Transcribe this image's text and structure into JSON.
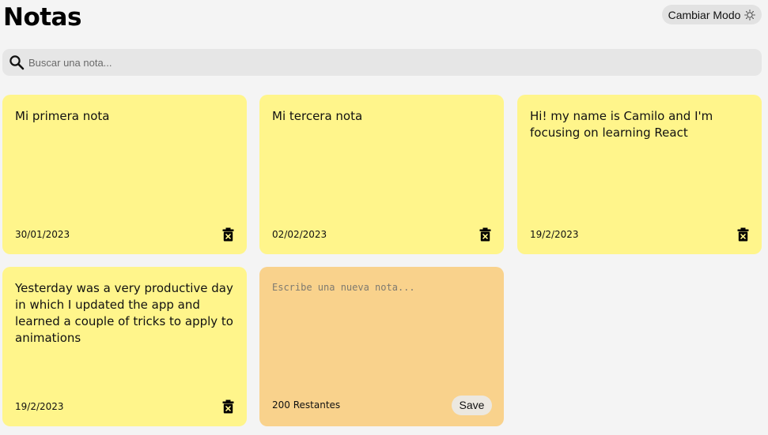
{
  "header": {
    "title": "Notas",
    "mode_button_label": "Cambiar Modo",
    "mode_icon": "sun-icon"
  },
  "search": {
    "icon": "search-icon",
    "placeholder": "Buscar una nota...",
    "value": ""
  },
  "notes": [
    {
      "text": "Mi primera nota",
      "date": "30/01/2023"
    },
    {
      "text": "Mi tercera nota",
      "date": "02/02/2023"
    },
    {
      "text": "Hi! my name is Camilo and I'm focusing on learning React",
      "date": "19/2/2023"
    },
    {
      "text": "Yesterday was a very productive day in which I updated the app and learned a couple of tricks to apply to animations",
      "date": "19/2/2023"
    }
  ],
  "new_note": {
    "placeholder": "Escribe una nueva nota...",
    "value": "",
    "remaining_label": "200 Restantes",
    "save_label": "Save"
  },
  "colors": {
    "background": "#f4f4f4",
    "note": "#fff58b",
    "new_note": "#f9d28c",
    "search": "#e6e6e6"
  }
}
